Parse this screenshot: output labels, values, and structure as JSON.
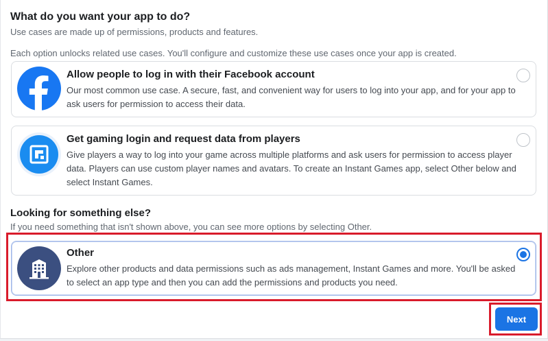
{
  "heading": "What do you want your app to do?",
  "subheading": "Use cases are made up of permissions, products and features.",
  "intro": "Each option unlocks related use cases. You'll configure and customize these use cases once your app is created.",
  "options": [
    {
      "title": "Allow people to log in with their Facebook account",
      "description": "Our most common use case. A secure, fast, and convenient way for users to log into your app, and for your app to ask users for permission to access their data.",
      "icon": "facebook-logo-icon",
      "selected": false
    },
    {
      "title": "Get gaming login and request data from players",
      "description": "Give players a way to log into your game across multiple platforms and ask users for permission to access player data. Players can use custom player names and avatars. To create an Instant Games app, select Other below and select Instant Games.",
      "icon": "gaming-icon",
      "selected": false
    }
  ],
  "other_section": {
    "heading": "Looking for something else?",
    "subheading": "If you need something that isn't shown above, you can see more options by selecting Other."
  },
  "other_option": {
    "title": "Other",
    "description": "Explore other products and data permissions such as ads management, Instant Games and more. You'll be asked to select an app type and then you can add the permissions and products you need.",
    "icon": "building-icon",
    "selected": true
  },
  "next_label": "Next",
  "colors": {
    "primary": "#1b74e4",
    "facebook_blue": "#1877f2",
    "building_navy": "#3b4f80",
    "highlight_red": "#d91b2b"
  }
}
